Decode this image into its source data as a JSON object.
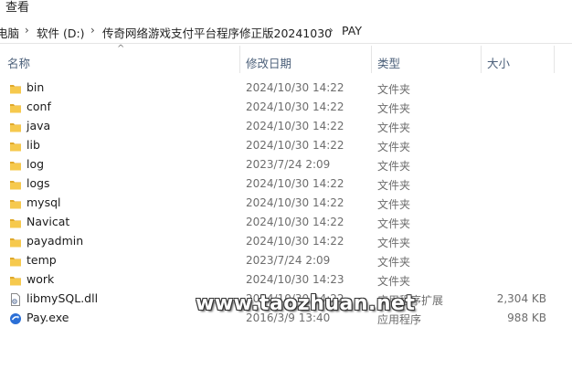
{
  "menu": {
    "view_label": "查看"
  },
  "address": {
    "crumbs": [
      "电脑",
      "软件 (D:)",
      "传奇网络游戏支付平台程序修正版20241030",
      "PAY"
    ]
  },
  "columns": {
    "name": "名称",
    "date": "修改日期",
    "type": "类型",
    "size": "大小"
  },
  "files": [
    {
      "name": "bin",
      "date": "2024/10/30 14:22",
      "type": "文件夹",
      "size": "",
      "icon": "folder-icon"
    },
    {
      "name": "conf",
      "date": "2024/10/30 14:22",
      "type": "文件夹",
      "size": "",
      "icon": "folder-icon"
    },
    {
      "name": "java",
      "date": "2024/10/30 14:22",
      "type": "文件夹",
      "size": "",
      "icon": "folder-icon"
    },
    {
      "name": "lib",
      "date": "2024/10/30 14:22",
      "type": "文件夹",
      "size": "",
      "icon": "folder-icon"
    },
    {
      "name": "log",
      "date": "2023/7/24 2:09",
      "type": "文件夹",
      "size": "",
      "icon": "folder-icon"
    },
    {
      "name": "logs",
      "date": "2024/10/30 14:22",
      "type": "文件夹",
      "size": "",
      "icon": "folder-icon"
    },
    {
      "name": "mysql",
      "date": "2024/10/30 14:22",
      "type": "文件夹",
      "size": "",
      "icon": "folder-icon"
    },
    {
      "name": "Navicat",
      "date": "2024/10/30 14:22",
      "type": "文件夹",
      "size": "",
      "icon": "folder-icon"
    },
    {
      "name": "payadmin",
      "date": "2024/10/30 14:22",
      "type": "文件夹",
      "size": "",
      "icon": "folder-icon"
    },
    {
      "name": "temp",
      "date": "2023/7/24 2:09",
      "type": "文件夹",
      "size": "",
      "icon": "folder-icon"
    },
    {
      "name": "work",
      "date": "2024/10/30 14:23",
      "type": "文件夹",
      "size": "",
      "icon": "folder-icon"
    },
    {
      "name": "libmySQL.dll",
      "date": "2014/10/30 14:22",
      "type": "应用程序扩展",
      "size": "2,304 KB",
      "icon": "dll-file-icon"
    },
    {
      "name": "Pay.exe",
      "date": "2016/3/9 13:40",
      "type": "应用程序",
      "size": "988 KB",
      "icon": "exe-file-icon"
    }
  ],
  "watermark": {
    "text": "www.taozhuan.net"
  },
  "colors": {
    "folder": "#f6c94d",
    "folder_dark": "#e0a92b",
    "header_text": "#4c607a",
    "secondary_text": "#6d6d6d"
  }
}
